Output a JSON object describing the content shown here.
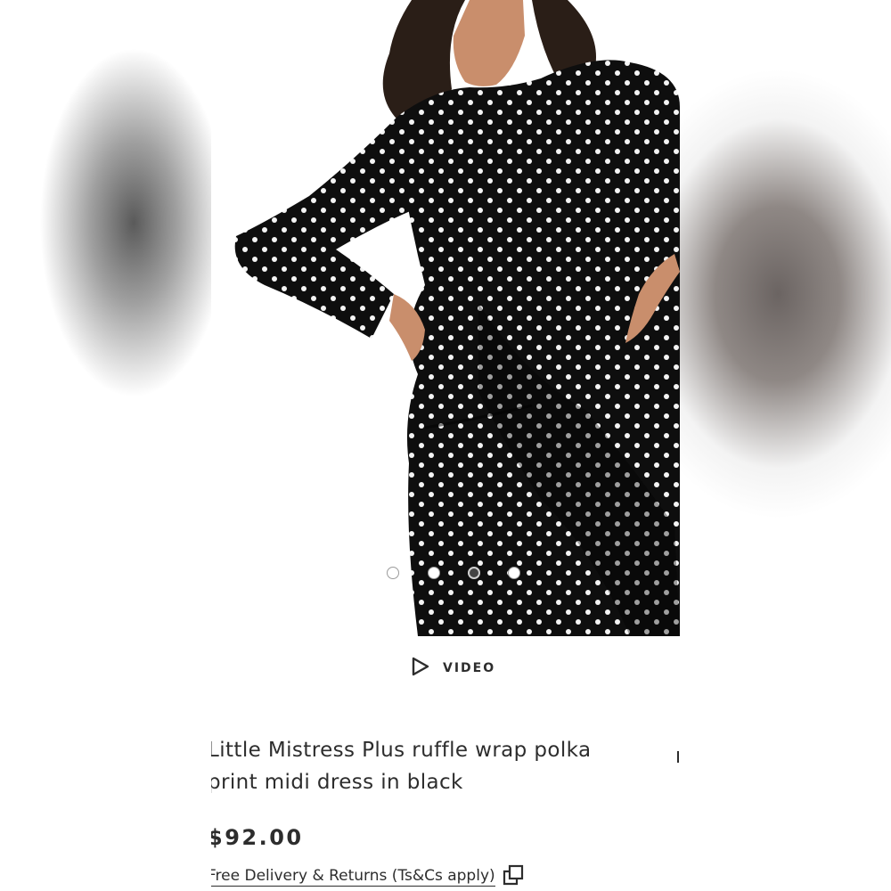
{
  "gallery": {
    "indicator_count": 4,
    "active_index": 2
  },
  "video": {
    "label": "VIDEO",
    "icon": "play-icon"
  },
  "product": {
    "title_line1": "Little Mistress Plus ruffle wrap polka",
    "title_line2": "print midi dress in black",
    "price": "$92.00"
  },
  "delivery": {
    "text": "Free Delivery & Returns (Ts&Cs apply)",
    "icon": "external-window-icon"
  },
  "colors": {
    "text": "#2d2d2d",
    "dress": "#0e0e0e",
    "polka": "#ffffff"
  }
}
